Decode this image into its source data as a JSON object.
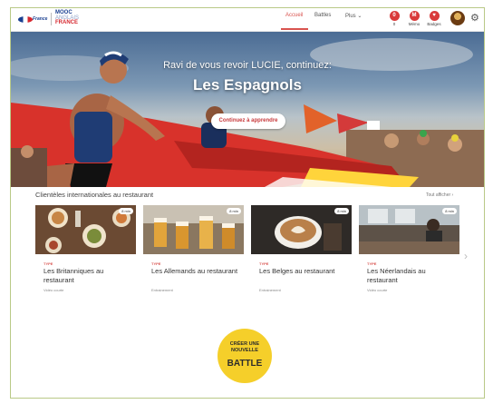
{
  "header": {
    "brand_fr": "France",
    "brand_mooc": [
      "MOOC",
      "ANGLAIS",
      "FRANCE"
    ],
    "nav": {
      "home": "Accueil",
      "battles": "Battles",
      "more": "Plus"
    },
    "buttons": [
      {
        "label": "0",
        "icon": "0"
      },
      {
        "label": "Mémo",
        "icon": "M"
      },
      {
        "label": "Badges",
        "icon": "♥"
      }
    ],
    "accent_color": "#d9534f"
  },
  "hero": {
    "greeting": "Ravi de vous revoir LUCIE, continuez:",
    "course": "Les Espagnols",
    "cta": "Continuez à apprendre"
  },
  "section": {
    "title": "Clientèles internationales au restaurant",
    "see_all": "Tout afficher",
    "cards": [
      {
        "tag": "TYPE",
        "title": "Les Britanniques au restaurant",
        "sub": "Vidéo courte",
        "badge": "8 min"
      },
      {
        "tag": "TYPE",
        "title": "Les Allemands au restaurant",
        "sub": "Entrainement",
        "badge": "8 min"
      },
      {
        "tag": "TYPE",
        "title": "Les Belges au restaurant",
        "sub": "Entrainement",
        "badge": "8 min"
      },
      {
        "tag": "TYPE",
        "title": "Les Néerlandais au restaurant",
        "sub": "Vidéo courte",
        "badge": "8 min"
      }
    ]
  },
  "battle": {
    "line1": "CRÉER UNE NOUVELLE",
    "line2": "BATTLE"
  }
}
